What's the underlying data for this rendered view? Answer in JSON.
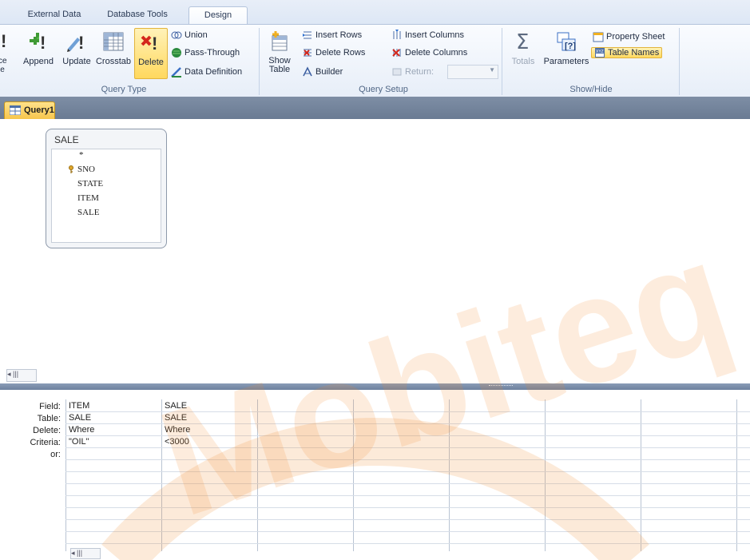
{
  "ribbon": {
    "tabs": [
      {
        "label": "External Data"
      },
      {
        "label": "Database Tools"
      },
      {
        "label": "Design"
      }
    ],
    "query_type": {
      "partial_left": "!",
      "partial_left_label": "ce\nle",
      "append": "Append",
      "update": "Update",
      "crosstab": "Crosstab",
      "delete": "Delete",
      "union": "Union",
      "pass_through": "Pass-Through",
      "data_definition": "Data Definition",
      "group_label": "Query Type"
    },
    "query_setup": {
      "show_table_line1": "Show",
      "show_table_line2": "Table",
      "insert_rows": "Insert Rows",
      "delete_rows": "Delete Rows",
      "builder": "Builder",
      "insert_columns": "Insert Columns",
      "delete_columns": "Delete Columns",
      "return_label": "Return:",
      "return_value": "",
      "group_label": "Query Setup"
    },
    "show_hide": {
      "totals": "Totals",
      "parameters": "Parameters",
      "property_sheet": "Property Sheet",
      "table_names": "Table Names",
      "group_label": "Show/Hide"
    }
  },
  "document": {
    "tab_label": "Query1"
  },
  "table_box": {
    "title": "SALE",
    "fields": [
      "*",
      "SNO",
      "STATE",
      "ITEM",
      "SALE"
    ]
  },
  "grid": {
    "row_labels": [
      "Field:",
      "Table:",
      "Delete:",
      "Criteria:",
      "or:"
    ],
    "columns": [
      {
        "field": "ITEM",
        "table": "SALE",
        "delete": "Where",
        "criteria": "\"OIL\"",
        "or": ""
      },
      {
        "field": "SALE",
        "table": "SALE",
        "delete": "Where",
        "criteria": "<3000",
        "or": ""
      }
    ]
  },
  "scroll": {
    "upper_glyph": "◂ |||",
    "lower_glyph": "◂ |||"
  },
  "watermark": {
    "text": "Mobiteq Aca"
  },
  "colors": {
    "accent_highlight": "#ffd85e",
    "ribbon_bg": "#e7eef8",
    "docbar": "#6a7b93",
    "watermark_orange": "#f08a2c"
  }
}
